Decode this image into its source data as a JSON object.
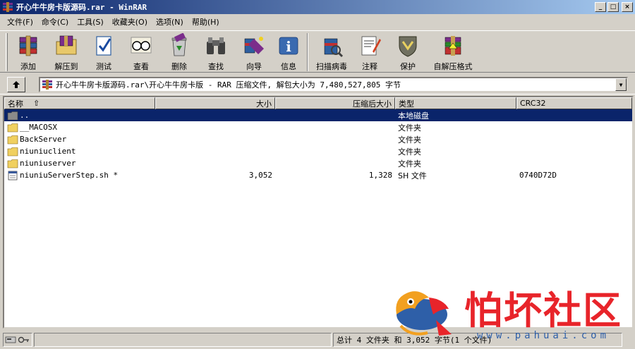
{
  "window": {
    "title": "开心牛牛房卡版源码.rar - WinRAR",
    "buttons": {
      "minimize": "_",
      "maximize": "□",
      "close": "×"
    }
  },
  "menu": [
    "文件(F)",
    "命令(C)",
    "工具(S)",
    "收藏夹(O)",
    "选项(N)",
    "帮助(H)"
  ],
  "toolbar": [
    {
      "label": "添加",
      "icon": "add-books-icon"
    },
    {
      "label": "解压到",
      "icon": "extract-folder-icon"
    },
    {
      "label": "测试",
      "icon": "test-check-icon"
    },
    {
      "label": "查看",
      "icon": "view-glasses-icon"
    },
    {
      "label": "删除",
      "icon": "delete-recycle-icon"
    },
    {
      "label": "查找",
      "icon": "find-binoculars-icon"
    },
    {
      "label": "向导",
      "icon": "wizard-icon"
    },
    {
      "label": "信息",
      "icon": "info-icon"
    },
    {
      "label": "扫描病毒",
      "icon": "virus-scan-icon"
    },
    {
      "label": "注释",
      "icon": "comment-icon"
    },
    {
      "label": "保护",
      "icon": "protect-shield-icon"
    },
    {
      "label": "自解压格式",
      "icon": "sfx-icon"
    }
  ],
  "address": {
    "path": "开心牛牛房卡版源码.rar\\开心牛牛房卡版 - RAR 压缩文件, 解包大小为 7,480,527,805 字节",
    "dropdown": "▼"
  },
  "columns": [
    "名称",
    "大小",
    "压缩后大小",
    "类型",
    "CRC32"
  ],
  "sort_indicator": "⇧",
  "rows": [
    {
      "name": "..",
      "size": "",
      "packed": "",
      "type": "本地磁盘",
      "crc": "",
      "icon": "parent-folder-icon",
      "selected": true
    },
    {
      "name": "__MACOSX",
      "size": "",
      "packed": "",
      "type": "文件夹",
      "crc": "",
      "icon": "folder-icon",
      "selected": false
    },
    {
      "name": "BackServer",
      "size": "",
      "packed": "",
      "type": "文件夹",
      "crc": "",
      "icon": "folder-icon",
      "selected": false
    },
    {
      "name": "niuniuclient",
      "size": "",
      "packed": "",
      "type": "文件夹",
      "crc": "",
      "icon": "folder-icon",
      "selected": false
    },
    {
      "name": "niuniuserver",
      "size": "",
      "packed": "",
      "type": "文件夹",
      "crc": "",
      "icon": "folder-icon",
      "selected": false
    },
    {
      "name": "niuniuServerStep.sh *",
      "size": "3,052",
      "packed": "1,328",
      "type": "SH 文件",
      "crc": "0740D72D",
      "icon": "file-icon",
      "selected": false
    }
  ],
  "status": {
    "summary": "总计 4 文件夹 和 3,052 字节(1 个文件)"
  },
  "watermark": {
    "text": "怕坏社区",
    "url": "www.pahuai.com"
  },
  "colors": {
    "titlebar_start": "#0a246a",
    "titlebar_end": "#a6caf0",
    "selection": "#0a246a",
    "watermark_red": "#e8242a",
    "watermark_blue": "#2e5fa8"
  }
}
